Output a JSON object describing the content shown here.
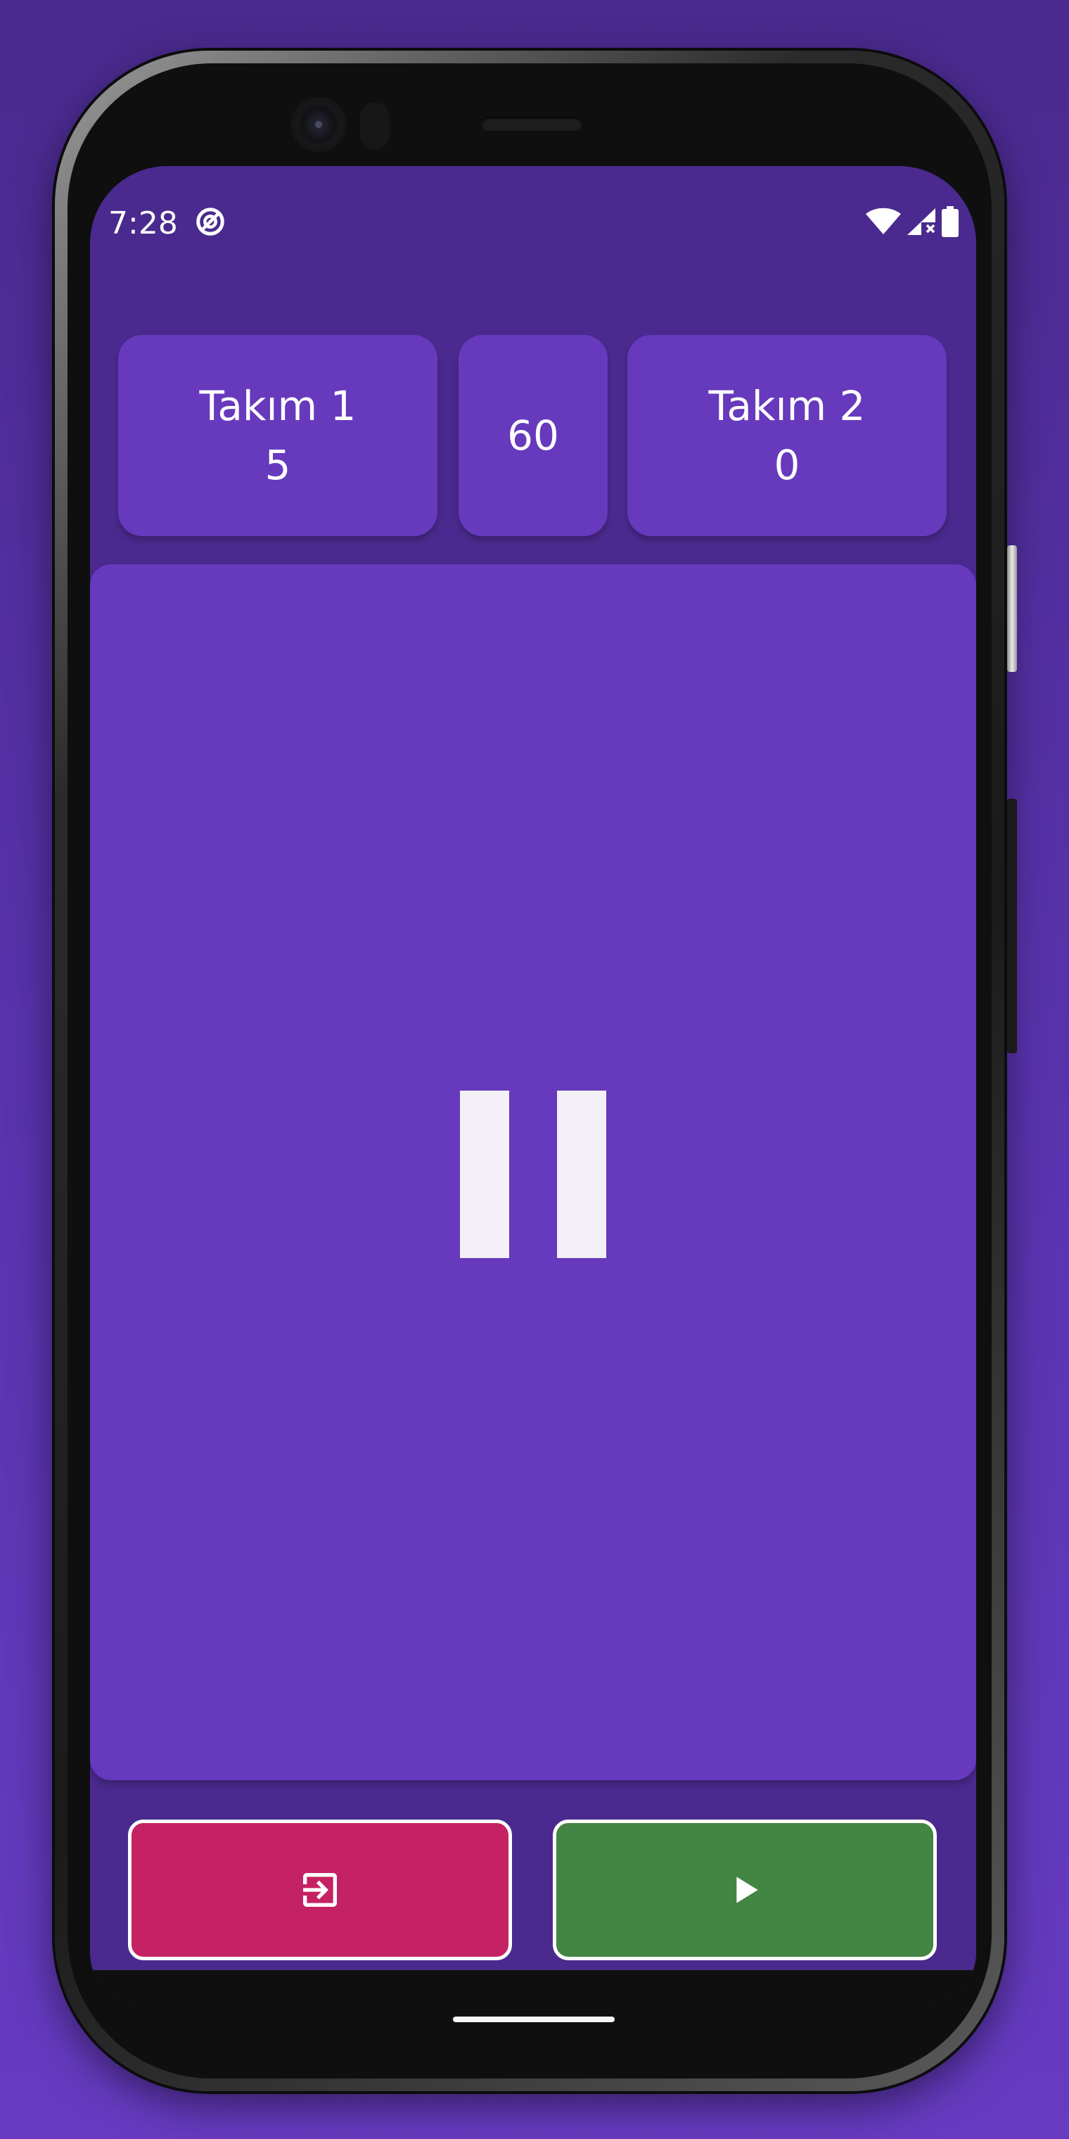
{
  "status_bar": {
    "time": "7:28",
    "app_icon": "data-saver-icon",
    "right_icons": [
      "wifi-icon",
      "cell-signal-icon",
      "battery-icon"
    ]
  },
  "scoreboard": {
    "team1": {
      "name": "Takım 1",
      "score": "5"
    },
    "timer": "60",
    "team2": {
      "name": "Takım 2",
      "score": "0"
    }
  },
  "play_area": {
    "state_icon": "pause-icon"
  },
  "actions": {
    "exit": {
      "icon": "exit-icon",
      "color": "#c42262"
    },
    "play": {
      "icon": "play-icon",
      "color": "#438542"
    }
  },
  "theme": {
    "background": "#4a2a8e",
    "card": "#6639bd",
    "text": "#ffffff"
  }
}
